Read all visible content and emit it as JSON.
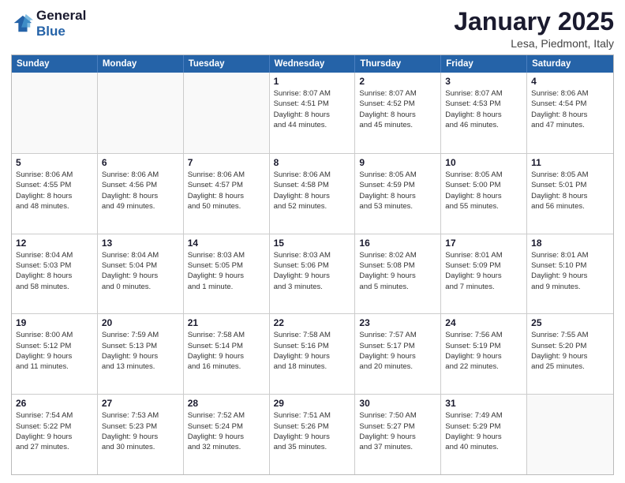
{
  "logo": {
    "line1": "General",
    "line2": "Blue"
  },
  "title": "January 2025",
  "subtitle": "Lesa, Piedmont, Italy",
  "weekdays": [
    "Sunday",
    "Monday",
    "Tuesday",
    "Wednesday",
    "Thursday",
    "Friday",
    "Saturday"
  ],
  "weeks": [
    [
      {
        "day": "",
        "info": ""
      },
      {
        "day": "",
        "info": ""
      },
      {
        "day": "",
        "info": ""
      },
      {
        "day": "1",
        "info": "Sunrise: 8:07 AM\nSunset: 4:51 PM\nDaylight: 8 hours\nand 44 minutes."
      },
      {
        "day": "2",
        "info": "Sunrise: 8:07 AM\nSunset: 4:52 PM\nDaylight: 8 hours\nand 45 minutes."
      },
      {
        "day": "3",
        "info": "Sunrise: 8:07 AM\nSunset: 4:53 PM\nDaylight: 8 hours\nand 46 minutes."
      },
      {
        "day": "4",
        "info": "Sunrise: 8:06 AM\nSunset: 4:54 PM\nDaylight: 8 hours\nand 47 minutes."
      }
    ],
    [
      {
        "day": "5",
        "info": "Sunrise: 8:06 AM\nSunset: 4:55 PM\nDaylight: 8 hours\nand 48 minutes."
      },
      {
        "day": "6",
        "info": "Sunrise: 8:06 AM\nSunset: 4:56 PM\nDaylight: 8 hours\nand 49 minutes."
      },
      {
        "day": "7",
        "info": "Sunrise: 8:06 AM\nSunset: 4:57 PM\nDaylight: 8 hours\nand 50 minutes."
      },
      {
        "day": "8",
        "info": "Sunrise: 8:06 AM\nSunset: 4:58 PM\nDaylight: 8 hours\nand 52 minutes."
      },
      {
        "day": "9",
        "info": "Sunrise: 8:05 AM\nSunset: 4:59 PM\nDaylight: 8 hours\nand 53 minutes."
      },
      {
        "day": "10",
        "info": "Sunrise: 8:05 AM\nSunset: 5:00 PM\nDaylight: 8 hours\nand 55 minutes."
      },
      {
        "day": "11",
        "info": "Sunrise: 8:05 AM\nSunset: 5:01 PM\nDaylight: 8 hours\nand 56 minutes."
      }
    ],
    [
      {
        "day": "12",
        "info": "Sunrise: 8:04 AM\nSunset: 5:03 PM\nDaylight: 8 hours\nand 58 minutes."
      },
      {
        "day": "13",
        "info": "Sunrise: 8:04 AM\nSunset: 5:04 PM\nDaylight: 9 hours\nand 0 minutes."
      },
      {
        "day": "14",
        "info": "Sunrise: 8:03 AM\nSunset: 5:05 PM\nDaylight: 9 hours\nand 1 minute."
      },
      {
        "day": "15",
        "info": "Sunrise: 8:03 AM\nSunset: 5:06 PM\nDaylight: 9 hours\nand 3 minutes."
      },
      {
        "day": "16",
        "info": "Sunrise: 8:02 AM\nSunset: 5:08 PM\nDaylight: 9 hours\nand 5 minutes."
      },
      {
        "day": "17",
        "info": "Sunrise: 8:01 AM\nSunset: 5:09 PM\nDaylight: 9 hours\nand 7 minutes."
      },
      {
        "day": "18",
        "info": "Sunrise: 8:01 AM\nSunset: 5:10 PM\nDaylight: 9 hours\nand 9 minutes."
      }
    ],
    [
      {
        "day": "19",
        "info": "Sunrise: 8:00 AM\nSunset: 5:12 PM\nDaylight: 9 hours\nand 11 minutes."
      },
      {
        "day": "20",
        "info": "Sunrise: 7:59 AM\nSunset: 5:13 PM\nDaylight: 9 hours\nand 13 minutes."
      },
      {
        "day": "21",
        "info": "Sunrise: 7:58 AM\nSunset: 5:14 PM\nDaylight: 9 hours\nand 16 minutes."
      },
      {
        "day": "22",
        "info": "Sunrise: 7:58 AM\nSunset: 5:16 PM\nDaylight: 9 hours\nand 18 minutes."
      },
      {
        "day": "23",
        "info": "Sunrise: 7:57 AM\nSunset: 5:17 PM\nDaylight: 9 hours\nand 20 minutes."
      },
      {
        "day": "24",
        "info": "Sunrise: 7:56 AM\nSunset: 5:19 PM\nDaylight: 9 hours\nand 22 minutes."
      },
      {
        "day": "25",
        "info": "Sunrise: 7:55 AM\nSunset: 5:20 PM\nDaylight: 9 hours\nand 25 minutes."
      }
    ],
    [
      {
        "day": "26",
        "info": "Sunrise: 7:54 AM\nSunset: 5:22 PM\nDaylight: 9 hours\nand 27 minutes."
      },
      {
        "day": "27",
        "info": "Sunrise: 7:53 AM\nSunset: 5:23 PM\nDaylight: 9 hours\nand 30 minutes."
      },
      {
        "day": "28",
        "info": "Sunrise: 7:52 AM\nSunset: 5:24 PM\nDaylight: 9 hours\nand 32 minutes."
      },
      {
        "day": "29",
        "info": "Sunrise: 7:51 AM\nSunset: 5:26 PM\nDaylight: 9 hours\nand 35 minutes."
      },
      {
        "day": "30",
        "info": "Sunrise: 7:50 AM\nSunset: 5:27 PM\nDaylight: 9 hours\nand 37 minutes."
      },
      {
        "day": "31",
        "info": "Sunrise: 7:49 AM\nSunset: 5:29 PM\nDaylight: 9 hours\nand 40 minutes."
      },
      {
        "day": "",
        "info": ""
      }
    ]
  ]
}
